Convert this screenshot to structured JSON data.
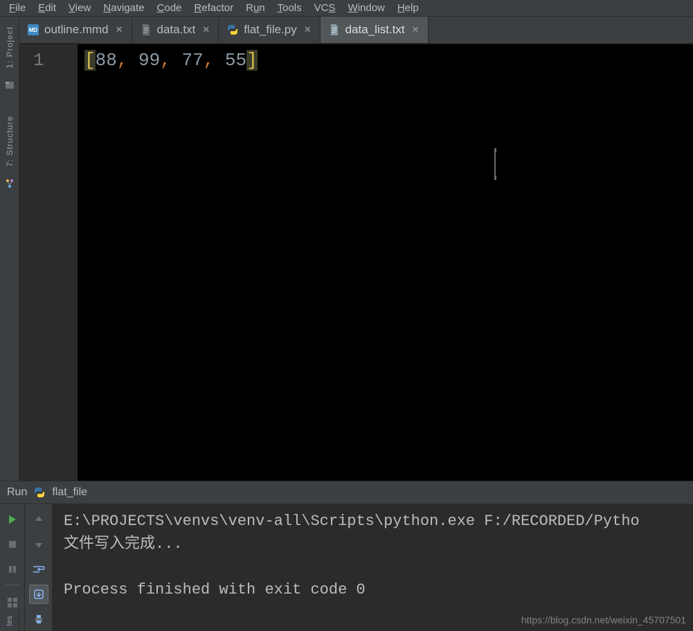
{
  "menu": {
    "file": "File",
    "edit": "Edit",
    "view": "View",
    "navigate": "Navigate",
    "code": "Code",
    "refactor": "Refactor",
    "run": "Run",
    "tools": "Tools",
    "vcs": "VCS",
    "window": "Window",
    "help": "Help"
  },
  "left_stripe": {
    "project": "1: Project",
    "structure": "7: Structure"
  },
  "tabs": [
    {
      "label": "outline.mmd",
      "icon": "mmd",
      "active": false
    },
    {
      "label": "data.txt",
      "icon": "txt",
      "active": false
    },
    {
      "label": "flat_file.py",
      "icon": "py",
      "active": false
    },
    {
      "label": "data_list.txt",
      "icon": "txt",
      "active": true
    }
  ],
  "editor": {
    "line_number": "1",
    "content_raw": "[88, 99, 77, 55]",
    "tokens": [
      {
        "t": "[",
        "cls": "bracket"
      },
      {
        "t": "88",
        "cls": "num"
      },
      {
        "t": ",",
        "cls": "comma"
      },
      {
        "t": " ",
        "cls": ""
      },
      {
        "t": "99",
        "cls": "num"
      },
      {
        "t": ",",
        "cls": "comma"
      },
      {
        "t": " ",
        "cls": ""
      },
      {
        "t": "77",
        "cls": "num"
      },
      {
        "t": ",",
        "cls": "comma"
      },
      {
        "t": " ",
        "cls": ""
      },
      {
        "t": "55",
        "cls": "num"
      },
      {
        "t": "]",
        "cls": "bracket"
      }
    ]
  },
  "run": {
    "title_prefix": "Run",
    "config_name": "flat_file",
    "console_lines": [
      "E:\\PROJECTS\\venvs\\venv-all\\Scripts\\python.exe F:/RECORDED/Pytho",
      "文件写入完成...",
      "",
      "Process finished with exit code 0"
    ]
  },
  "watermark": "https://blog.csdn.net/weixin_45707501"
}
